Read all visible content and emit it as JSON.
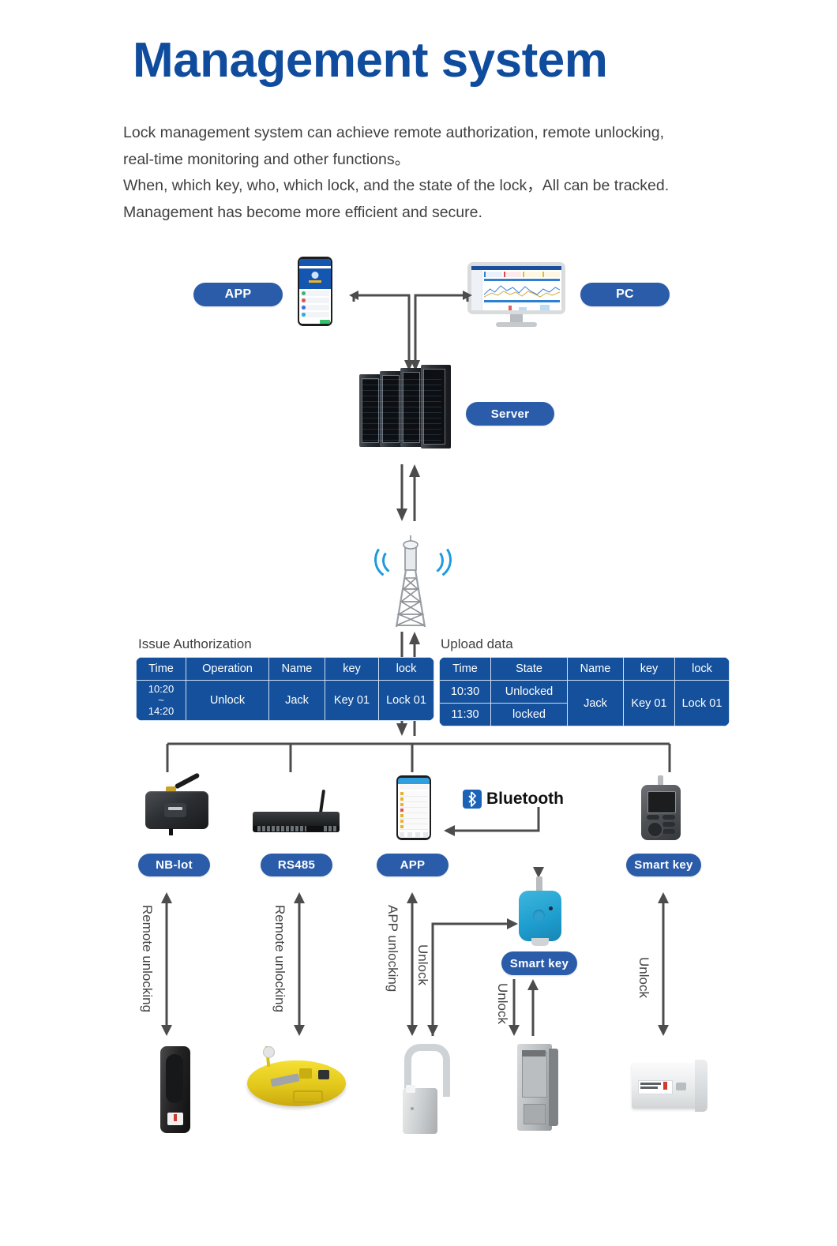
{
  "page_title": "Management system",
  "intro_lines": [
    "Lock management system can achieve remote authorization, remote unlocking,",
    "real-time monitoring and other functions。",
    "When, which key, who, which lock, and the state of the lock，All can be tracked.",
    "Management has become more efficient and secure."
  ],
  "colors": {
    "title_blue": "#0f4c9e",
    "badge_blue": "#2a5caa",
    "table_blue": "#14509b",
    "line_gray": "#4c4c4c",
    "wave_blue": "#1d9bdc",
    "fob_blue": "#1f9fd0"
  },
  "top_nodes": {
    "app_badge": "APP",
    "pc_badge": "PC",
    "server_badge": "Server"
  },
  "tables": {
    "issue": {
      "caption": "Issue Authorization",
      "headers": [
        "Time",
        "Operation",
        "Name",
        "key",
        "lock"
      ],
      "rows": [
        {
          "time": "10:20\n~\n14:20",
          "time_l1": "10:20",
          "time_l2": "~",
          "time_l3": "14:20",
          "operation": "Unlock",
          "name": "Jack",
          "key": "Key 01",
          "lock": "Lock 01"
        }
      ]
    },
    "upload": {
      "caption": "Upload data",
      "headers": [
        "Time",
        "State",
        "Name",
        "key",
        "lock"
      ],
      "rows": [
        {
          "time": "10:30",
          "state": "Unlocked"
        },
        {
          "time": "11:30",
          "state": "locked"
        }
      ],
      "merged": {
        "name": "Jack",
        "key": "Key 01",
        "lock": "Lock 01"
      }
    }
  },
  "channels": [
    {
      "badge": "NB-lot",
      "action": "Remote unlocking"
    },
    {
      "badge": "RS485",
      "action": "Remote unlocking"
    },
    {
      "badge": "APP",
      "action": "APP unlocking"
    },
    {
      "badge": "Smart key",
      "action": "Unlock"
    }
  ],
  "bluetooth_label": "Bluetooth",
  "smart_key_badge": "Smart key",
  "unlock_labels": {
    "app_to_fob": "Unlock",
    "fob_to_lock": "Unlock",
    "handheld_to_lock": "Unlock"
  },
  "icons": {
    "phone": "smartphone-icon",
    "monitor": "desktop-monitor-icon",
    "server": "server-rack-icon",
    "tower": "cell-tower-icon",
    "gateway": "nbiot-gateway-icon",
    "switch": "rs485-switch-icon",
    "handheld": "handheld-smart-key-icon",
    "fob": "key-fob-icon",
    "bluetooth": "bluetooth-icon",
    "lock_handle": "handle-lock-icon",
    "lock_manhole": "manhole-cover-lock-icon",
    "lock_padlock": "smart-padlock-icon",
    "lock_cabinet": "cabinet-lock-icon",
    "lock_box": "meter-box-lock-icon"
  }
}
